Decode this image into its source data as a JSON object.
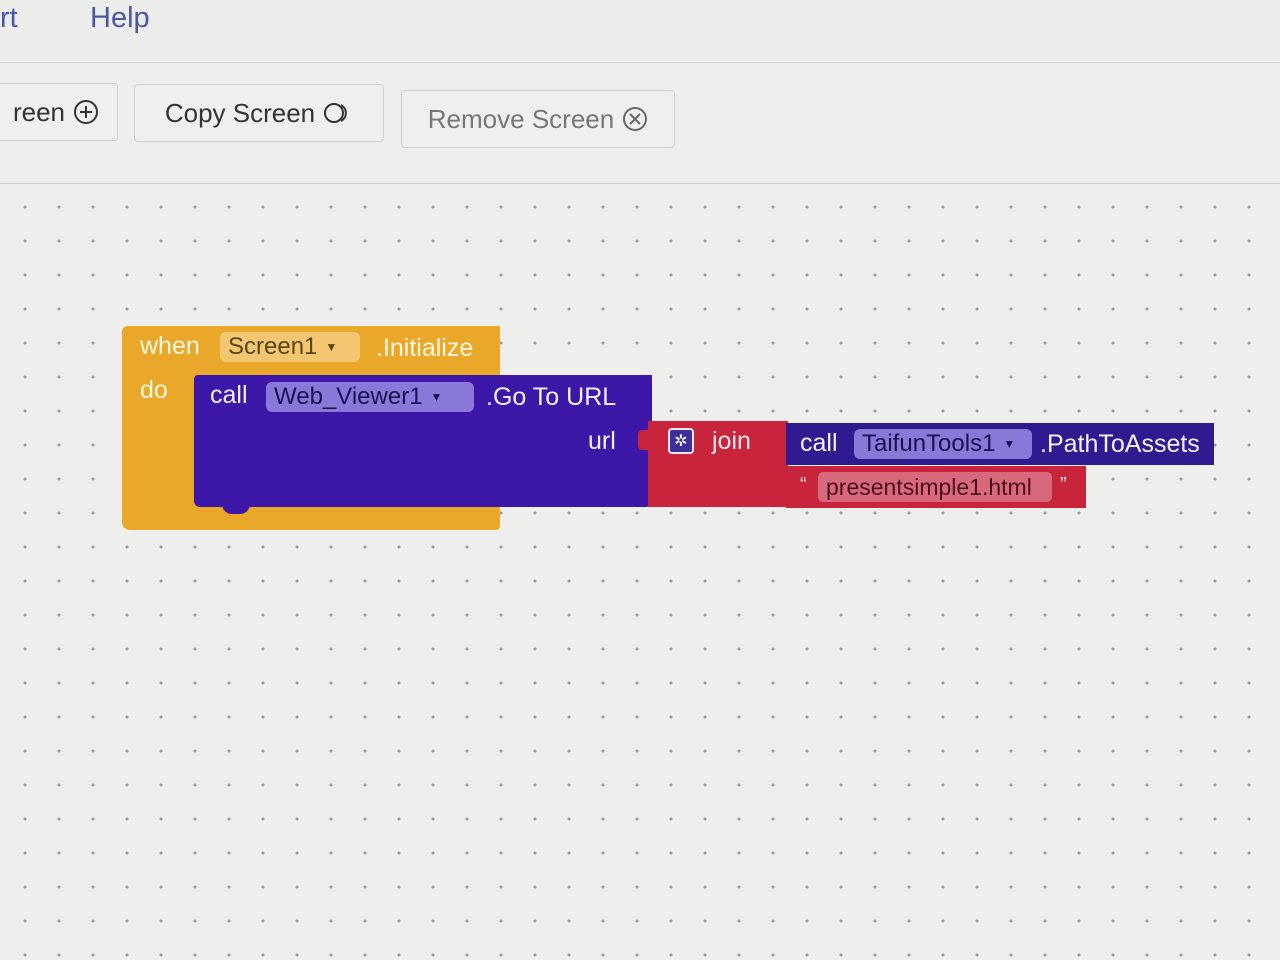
{
  "menu": {
    "items": [
      "rt",
      "Help"
    ]
  },
  "toolbar": {
    "add_screen_label": "reen",
    "copy_screen_label": "Copy Screen",
    "remove_screen_label": "Remove Screen"
  },
  "event_block": {
    "when_label": "when",
    "component": "Screen1",
    "event": ".Initialize",
    "do_label": "do"
  },
  "call_block": {
    "call_label": "call",
    "component": "Web_Viewer1",
    "method": ".Go To URL",
    "param_label": "url"
  },
  "join_block": {
    "label": "join"
  },
  "path_block": {
    "call_label": "call",
    "component": "TaifunTools1",
    "method": ".PathToAssets"
  },
  "text_block": {
    "open_quote": "“",
    "value": "presentsimple1.html",
    "close_quote": "”"
  },
  "colors": {
    "event_block": "#e9a82a",
    "component_call": "#3d17a8",
    "text_join": "#c8243c",
    "menu_link": "#4a57a5"
  },
  "icons": {
    "add_screen": "plus-circle-icon",
    "copy_screen": "copy-rings-icon",
    "remove_screen": "x-circle-icon",
    "mutator": "gear-icon",
    "dropdown": "triangle-down-icon"
  }
}
